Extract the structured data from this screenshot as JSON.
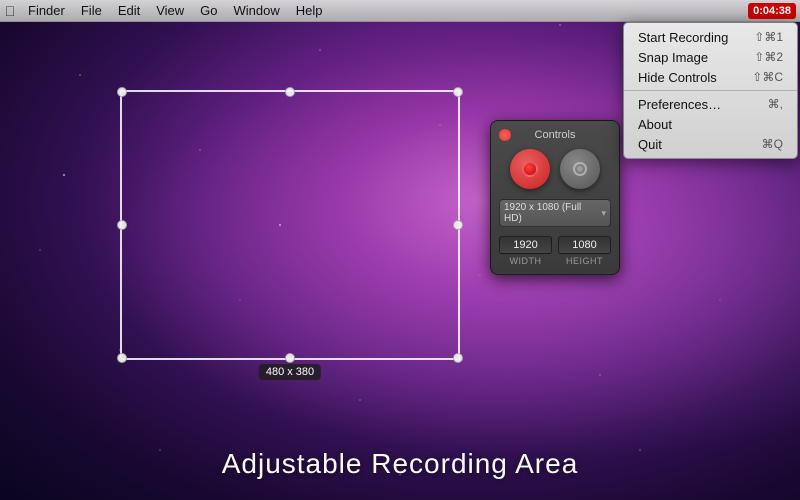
{
  "menubar": {
    "apple": "⌘",
    "items": [
      {
        "label": "Finder"
      },
      {
        "label": "File"
      },
      {
        "label": "Edit"
      },
      {
        "label": "View"
      },
      {
        "label": "Go"
      },
      {
        "label": "Window"
      },
      {
        "label": "Help"
      }
    ],
    "recording_time": "0:04:38"
  },
  "context_menu": {
    "items": [
      {
        "label": "Start Recording",
        "shortcut": "⇧⌘1"
      },
      {
        "label": "Snap Image",
        "shortcut": "⇧⌘2"
      },
      {
        "label": "Hide Controls",
        "shortcut": "⇧⌘C"
      },
      {
        "separator": true
      },
      {
        "label": "Preferences…",
        "shortcut": "⌘,"
      },
      {
        "label": "About",
        "shortcut": ""
      },
      {
        "label": "Quit",
        "shortcut": "⌘Q"
      }
    ]
  },
  "recording_area": {
    "size_label": "480 x 380"
  },
  "controls_panel": {
    "title": "Controls",
    "record_label": "Record",
    "snap_label": "Snap",
    "resolution": "1920 x 1080 (Full HD)",
    "width_value": "1920",
    "height_value": "1080",
    "width_label": "WIDTH",
    "height_label": "HEIGHT",
    "close_label": "Close"
  },
  "bottom_text": "Adjustable Recording Area"
}
